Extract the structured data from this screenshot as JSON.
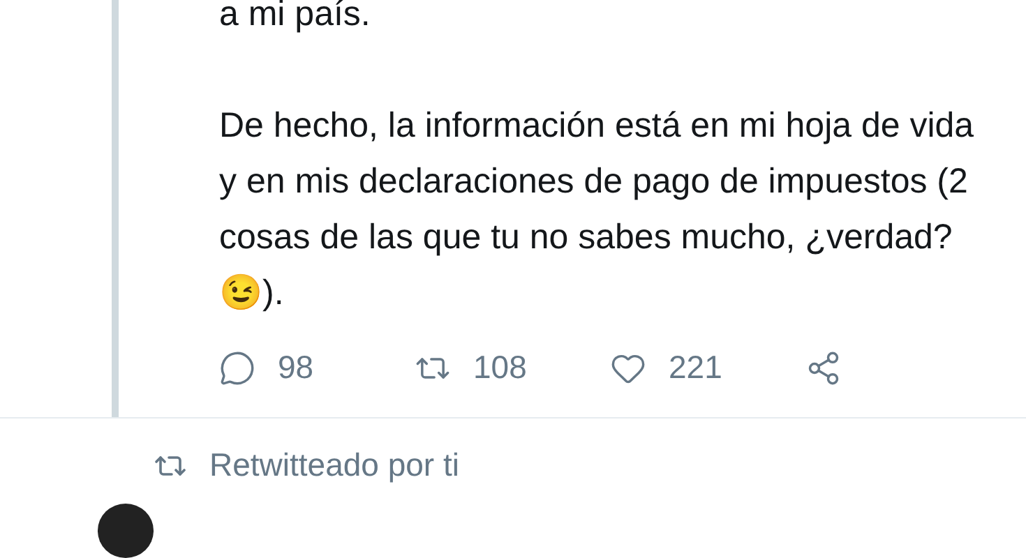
{
  "tweet": {
    "paragraphs": [
      "a mi país.",
      "De hecho, la información está en mi hoja de vida y en mis declaraciones de pago de impuestos (2 cosas de las que tu no sabes mucho, ¿verdad? 😉)."
    ],
    "actions": [
      {
        "kind": "reply",
        "count": "98"
      },
      {
        "kind": "retweet",
        "count": "108"
      },
      {
        "kind": "like",
        "count": "221"
      },
      {
        "kind": "share"
      }
    ]
  },
  "social_context": {
    "text": "Retwitteado por ti"
  }
}
